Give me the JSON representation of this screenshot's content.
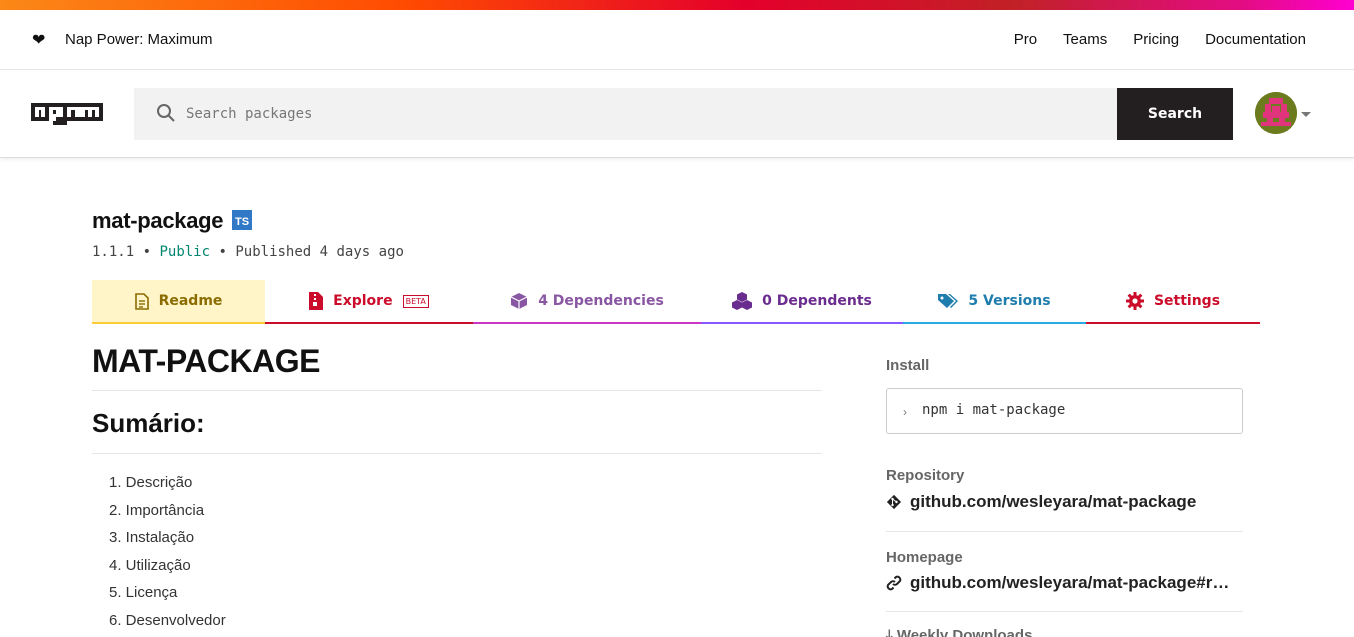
{
  "topbar": {
    "heart_icon": "❤",
    "nap_power": "Nap Power: Maximum",
    "nav": [
      "Pro",
      "Teams",
      "Pricing",
      "Documentation"
    ]
  },
  "search": {
    "placeholder": "Search packages",
    "button_label": "Search"
  },
  "package": {
    "name": "mat-package",
    "ts_badge": "TS",
    "version": "1.1.1",
    "bullet": "•",
    "visibility": "Public",
    "published": "Published 4 days ago"
  },
  "tabs": [
    {
      "label": "Readme",
      "color": "#8a6c00"
    },
    {
      "label": "Explore",
      "badge": "BETA",
      "color": "#cb0c2a"
    },
    {
      "label": "4 Dependencies",
      "color": "#8956a3"
    },
    {
      "label": "0 Dependents",
      "color": "#6b2c8f"
    },
    {
      "label": "5 Versions",
      "color": "#1f7dae"
    },
    {
      "label": "Settings",
      "color": "#cb0c2a"
    }
  ],
  "readme": {
    "h1": "MAT-PACKAGE",
    "h2": "Sumário:",
    "toc": [
      "1. Descrição",
      "2. Importância",
      "3. Instalação",
      "4. Utilização",
      "5. Licença",
      "6. Desenvolvedor"
    ]
  },
  "sidebar": {
    "install_label": "Install",
    "install_prompt": "›",
    "install_cmd": "npm i mat-package",
    "repository_label": "Repository",
    "repository": "github.com/wesleyara/mat-package",
    "homepage_label": "Homepage",
    "homepage": "github.com/wesleyara/mat-package#readme",
    "weekly_label": "Weekly Downloads"
  },
  "colors": {
    "readme_tab_bg": "#fff5c8",
    "ts_blue": "#3178c6",
    "public_green": "#00866f",
    "search_button": "#231f20"
  }
}
